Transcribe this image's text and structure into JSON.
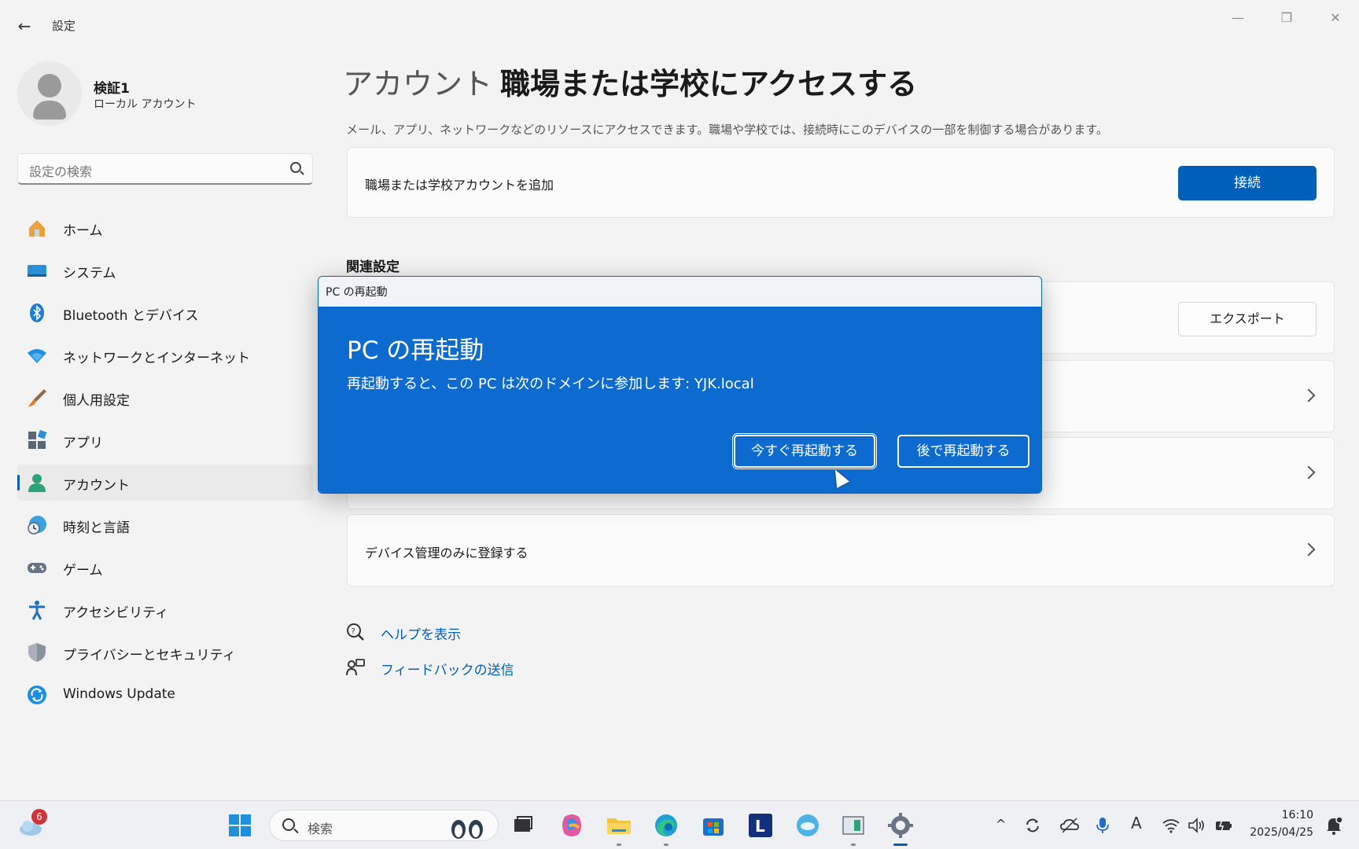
{
  "window": {
    "app_title": "設定",
    "back_icon": "←",
    "minimize_icon": "—",
    "restore_icon": "❐",
    "close_icon": "✕"
  },
  "profile": {
    "name": "検証1",
    "account_type": "ローカル アカウント"
  },
  "search": {
    "placeholder": "設定の検索"
  },
  "sidebar": {
    "items": [
      {
        "label": "ホーム",
        "icon": "home-icon"
      },
      {
        "label": "システム",
        "icon": "system-icon"
      },
      {
        "label": "Bluetooth とデバイス",
        "icon": "bluetooth-icon"
      },
      {
        "label": "ネットワークとインターネット",
        "icon": "wifi-icon"
      },
      {
        "label": "個人用設定",
        "icon": "brush-icon"
      },
      {
        "label": "アプリ",
        "icon": "apps-icon"
      },
      {
        "label": "アカウント",
        "icon": "account-icon",
        "selected": true
      },
      {
        "label": "時刻と言語",
        "icon": "time-language-icon"
      },
      {
        "label": "ゲーム",
        "icon": "gamepad-icon"
      },
      {
        "label": "アクセシビリティ",
        "icon": "accessibility-icon"
      },
      {
        "label": "プライバシーとセキュリティ",
        "icon": "shield-icon"
      },
      {
        "label": "Windows Update",
        "icon": "update-icon"
      }
    ]
  },
  "main": {
    "breadcrumb_parent": "アカウント",
    "breadcrumb_separator": "›",
    "page_title": "職場または学校にアクセスする",
    "description": "メール、アプリ、ネットワークなどのリソースにアクセスできます。職場や学校では、接続時にこのデバイスの一部を制御する場合があります。",
    "add_account_label": "職場または学校アカウントを追加",
    "connect_button": "接続",
    "related_heading": "関連設定",
    "export_button": "エクスポート",
    "enroll_label": "デバイス管理のみに登録する",
    "help_link": "ヘルプを表示",
    "feedback_link": "フィードバックの送信"
  },
  "dialog": {
    "window_title": "PC の再起動",
    "heading": "PC の再起動",
    "message": "再起動すると、この PC は次のドメインに参加します: YJK.local",
    "restart_now": "今すぐ再起動する",
    "restart_later": "後で再起動する"
  },
  "taskbar": {
    "search_placeholder": "検索",
    "notification_count": "6",
    "time": "16:10",
    "date": "2025/04/25",
    "ime_indicator": "A",
    "tray_chevron": "^"
  },
  "colors": {
    "accent": "#005fb8",
    "dialog_bg": "#0d6bd0"
  }
}
